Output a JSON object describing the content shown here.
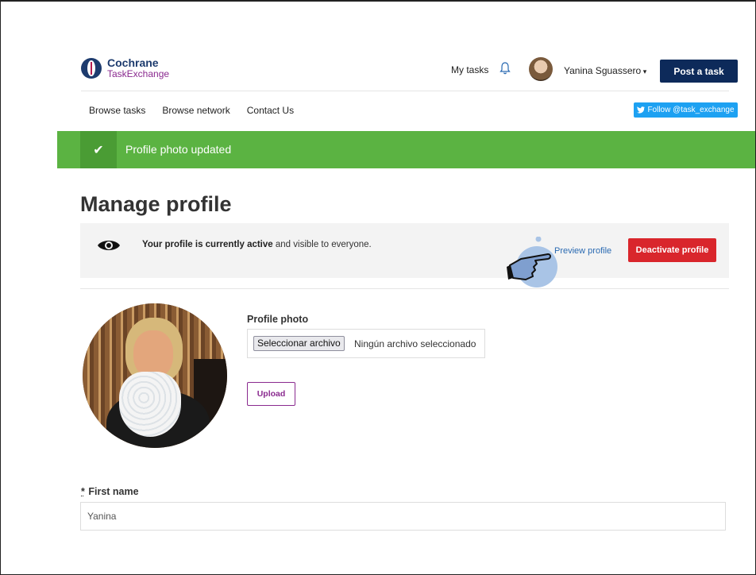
{
  "header": {
    "brand": "Cochrane",
    "brand_sub": "TaskExchange",
    "my_tasks": "My tasks",
    "user_name": "Yanina Sguassero",
    "post_task": "Post a task"
  },
  "nav": {
    "items": [
      {
        "label": "Browse tasks"
      },
      {
        "label": "Browse network"
      },
      {
        "label": "Contact Us"
      }
    ],
    "follow": "Follow @task_exchange"
  },
  "banner": {
    "message": "Profile photo updated",
    "color": "#5bb342"
  },
  "main": {
    "title": "Manage profile",
    "status_bold": "Your profile is currently active",
    "status_rest": " and visible to everyone.",
    "preview": "Preview profile",
    "deactivate": "Deactivate profile",
    "photo_label": "Profile photo",
    "file_button": "Seleccionar archivo",
    "file_status": "Ningún archivo seleccionado",
    "upload": "Upload",
    "first_name_required": "*",
    "first_name_label": "First name",
    "first_name_value": "Yanina"
  },
  "colors": {
    "navy": "#0d2a5a",
    "danger": "#d9262c",
    "purple": "#8a2a8f",
    "twitter": "#1da1f2"
  },
  "icons": [
    "cochrane-logo-icon",
    "bell-icon",
    "check-icon",
    "eye-icon",
    "pointing-hand-icon",
    "twitter-bird-icon"
  ]
}
